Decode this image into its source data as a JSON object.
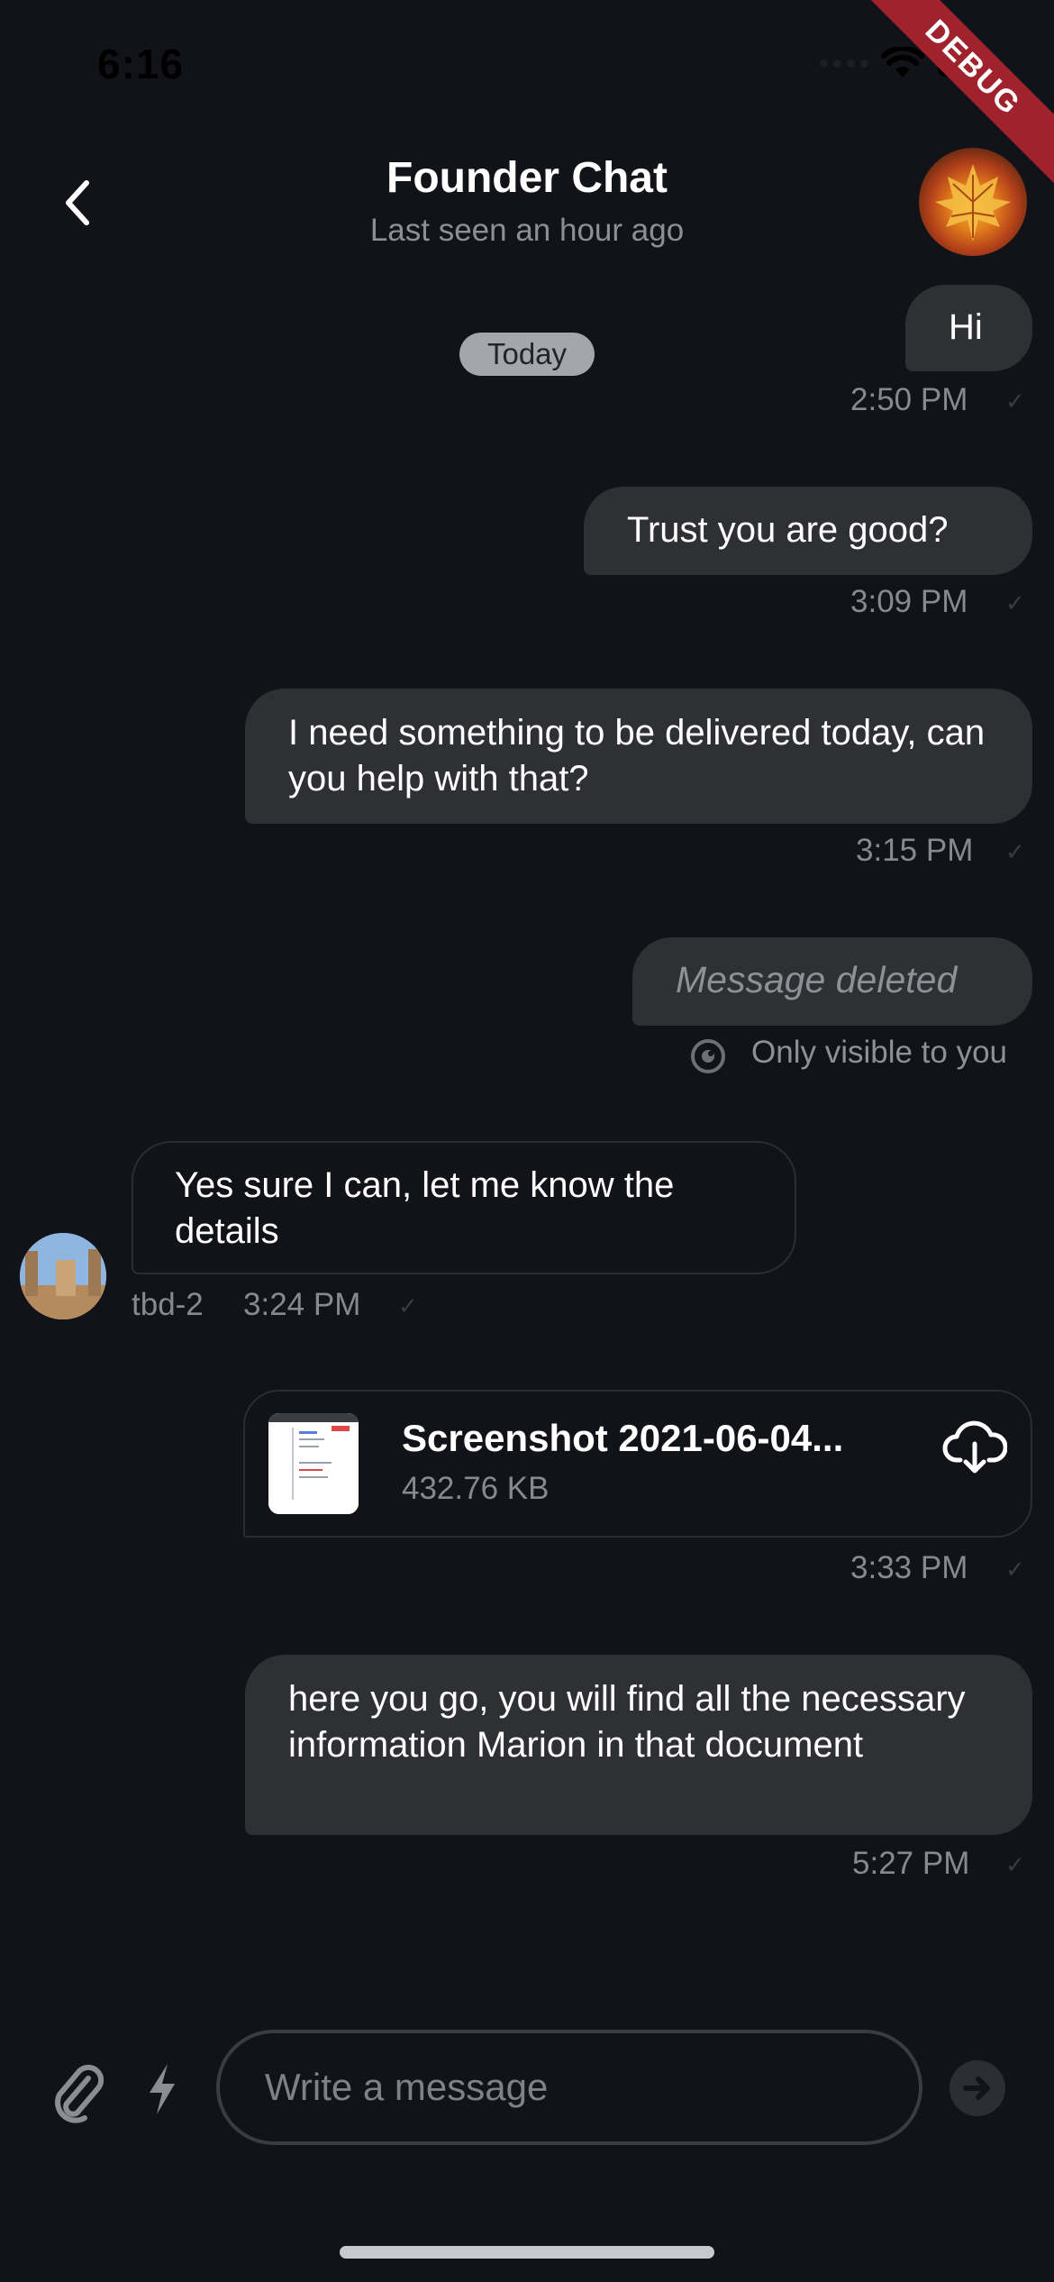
{
  "status_bar": {
    "time": "6:16",
    "debug_label": "DEBUG"
  },
  "header": {
    "title": "Founder Chat",
    "subtitle": "Last seen an hour ago",
    "back_icon": "chevron-left-icon",
    "avatar_icon": "maple-leaf-avatar"
  },
  "date_chip": "Today",
  "messages": [
    {
      "text": "Hi",
      "time": "2:50 PM",
      "direction": "outgoing",
      "status_icon": "check-icon"
    },
    {
      "text": "Trust you are good?",
      "time": "3:09 PM",
      "direction": "outgoing",
      "status_icon": "check-icon"
    },
    {
      "text": "I need something to be delivered today, can you help with that?",
      "time": "3:15 PM",
      "direction": "outgoing",
      "status_icon": "check-icon"
    },
    {
      "text": "Message deleted",
      "note": "Only visible to you",
      "direction": "outgoing",
      "status_icon": "eye-icon"
    },
    {
      "text": "Yes sure I can, let me know the details",
      "sender": "tbd-2",
      "time": "3:24 PM",
      "direction": "incoming",
      "status_icon": "check-icon"
    },
    {
      "file_name": "Screenshot 2021-06-04...",
      "file_size": "432.76 KB",
      "time": "3:33 PM",
      "direction": "outgoing",
      "action_icon": "cloud-download-icon"
    },
    {
      "text": "here you go, you will find all the necessary information Marion in that document",
      "time": "5:27 PM",
      "direction": "outgoing",
      "status_icon": "check-icon"
    }
  ],
  "composer": {
    "placeholder": "Write a message",
    "attach_icon": "paperclip-icon",
    "commands_icon": "lightning-bolt-icon",
    "send_icon": "send-arrow-icon"
  },
  "colors": {
    "background": "#111318",
    "bubble": "#2f3033",
    "secondary_text": "#86898f",
    "debug_banner": "#a0222d"
  }
}
